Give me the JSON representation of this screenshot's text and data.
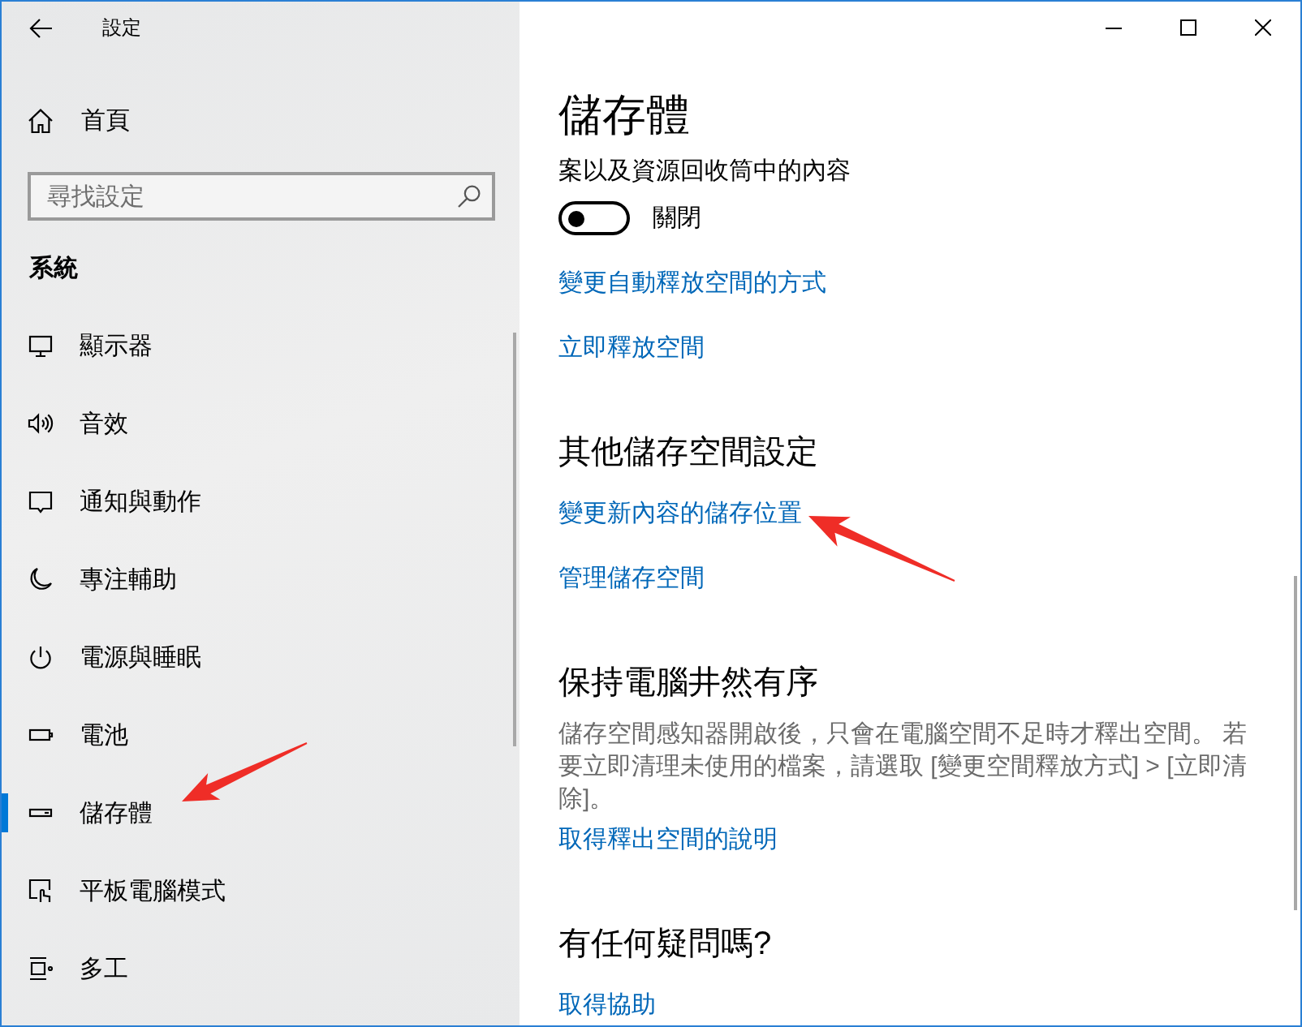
{
  "window": {
    "title": "設定"
  },
  "sidebar": {
    "home": {
      "label": "首頁"
    },
    "search": {
      "placeholder": "尋找設定"
    },
    "section": "系統",
    "items": [
      {
        "label": "顯示器",
        "selected": false,
        "arrow": false
      },
      {
        "label": "音效",
        "selected": false,
        "arrow": false
      },
      {
        "label": "通知與動作",
        "selected": false,
        "arrow": false
      },
      {
        "label": "專注輔助",
        "selected": false,
        "arrow": false
      },
      {
        "label": "電源與睡眠",
        "selected": false,
        "arrow": false
      },
      {
        "label": "電池",
        "selected": false,
        "arrow": false
      },
      {
        "label": "儲存體",
        "selected": true,
        "arrow": true
      },
      {
        "label": "平板電腦模式",
        "selected": false,
        "arrow": false
      },
      {
        "label": "多工",
        "selected": false,
        "arrow": false
      }
    ]
  },
  "page": {
    "title": "儲存體",
    "content": [
      {
        "kind": "text",
        "text": "案以及資源回收筒中的內容"
      },
      {
        "kind": "toggle",
        "on": false,
        "label": "關閉"
      },
      {
        "kind": "link",
        "text": "變更自動釋放空間的方式",
        "arrow": false
      },
      {
        "kind": "link",
        "text": "立即釋放空間",
        "arrow": false
      },
      {
        "kind": "heading",
        "text": "其他儲存空間設定"
      },
      {
        "kind": "link",
        "text": "變更新內容的儲存位置",
        "arrow": true
      },
      {
        "kind": "link",
        "text": "管理儲存空間",
        "arrow": false
      },
      {
        "kind": "heading",
        "text": "保持電腦井然有序"
      },
      {
        "kind": "paragraph",
        "text": "儲存空間感知器開啟後，只會在電腦空間不足時才釋出空間。 若要立即清理未使用的檔案，請選取 [變更空間釋放方式] > [立即清除]。"
      },
      {
        "kind": "link",
        "text": "取得釋出空間的說明",
        "arrow": false
      },
      {
        "kind": "heading",
        "text": "有任何疑問嗎?"
      },
      {
        "kind": "link",
        "text": "取得協助",
        "arrow": false
      }
    ]
  }
}
